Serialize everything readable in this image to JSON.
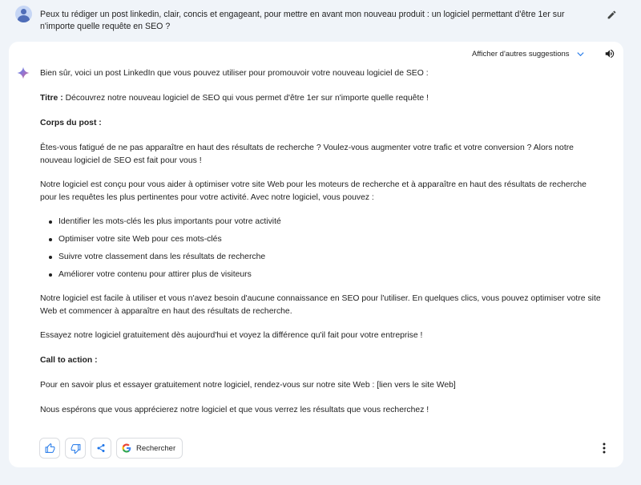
{
  "prompt": {
    "text": "Peux tu rédiger un post linkedin, clair, concis et engageant, pour mettre en avant mon nouveau produit : un logiciel permettant d'être 1er sur n'importe quelle requête en SEO ?"
  },
  "response_header": {
    "suggestions_label": "Afficher d'autres suggestions"
  },
  "answer": {
    "intro": "Bien sûr, voici un post LinkedIn que vous pouvez utiliser pour promouvoir votre nouveau logiciel de SEO :",
    "title_label": "Titre :",
    "title_text": " Découvrez notre nouveau logiciel de SEO qui vous permet d'être 1er sur n'importe quelle requête !",
    "body_heading": "Corps du post :",
    "para1": "Êtes-vous fatigué de ne pas apparaître en haut des résultats de recherche ? Voulez-vous augmenter votre trafic et votre conversion ? Alors notre nouveau logiciel de SEO est fait pour vous !",
    "para2": "Notre logiciel est conçu pour vous aider à optimiser votre site Web pour les moteurs de recherche et à apparaître en haut des résultats de recherche pour les requêtes les plus pertinentes pour votre activité. Avec notre logiciel, vous pouvez :",
    "bullets": [
      "Identifier les mots-clés les plus importants pour votre activité",
      "Optimiser votre site Web pour ces mots-clés",
      "Suivre votre classement dans les résultats de recherche",
      "Améliorer votre contenu pour attirer plus de visiteurs"
    ],
    "para3": "Notre logiciel est facile à utiliser et vous n'avez besoin d'aucune connaissance en SEO pour l'utiliser. En quelques clics, vous pouvez optimiser votre site Web et commencer à apparaître en haut des résultats de recherche.",
    "para4": "Essayez notre logiciel gratuitement dès aujourd'hui et voyez la différence qu'il fait pour votre entreprise !",
    "cta_heading": "Call to action :",
    "para5": "Pour en savoir plus et essayer gratuitement notre logiciel, rendez-vous sur notre site Web : [lien vers le site Web]",
    "para6": "Nous espérons que vous apprécierez notre logiciel et que vous verrez les résultats que vous recherchez !"
  },
  "actions": {
    "search_label": "Rechercher"
  },
  "colors": {
    "background": "#f0f4f9",
    "card": "#ffffff",
    "accent_blue": "#1a73e8"
  }
}
